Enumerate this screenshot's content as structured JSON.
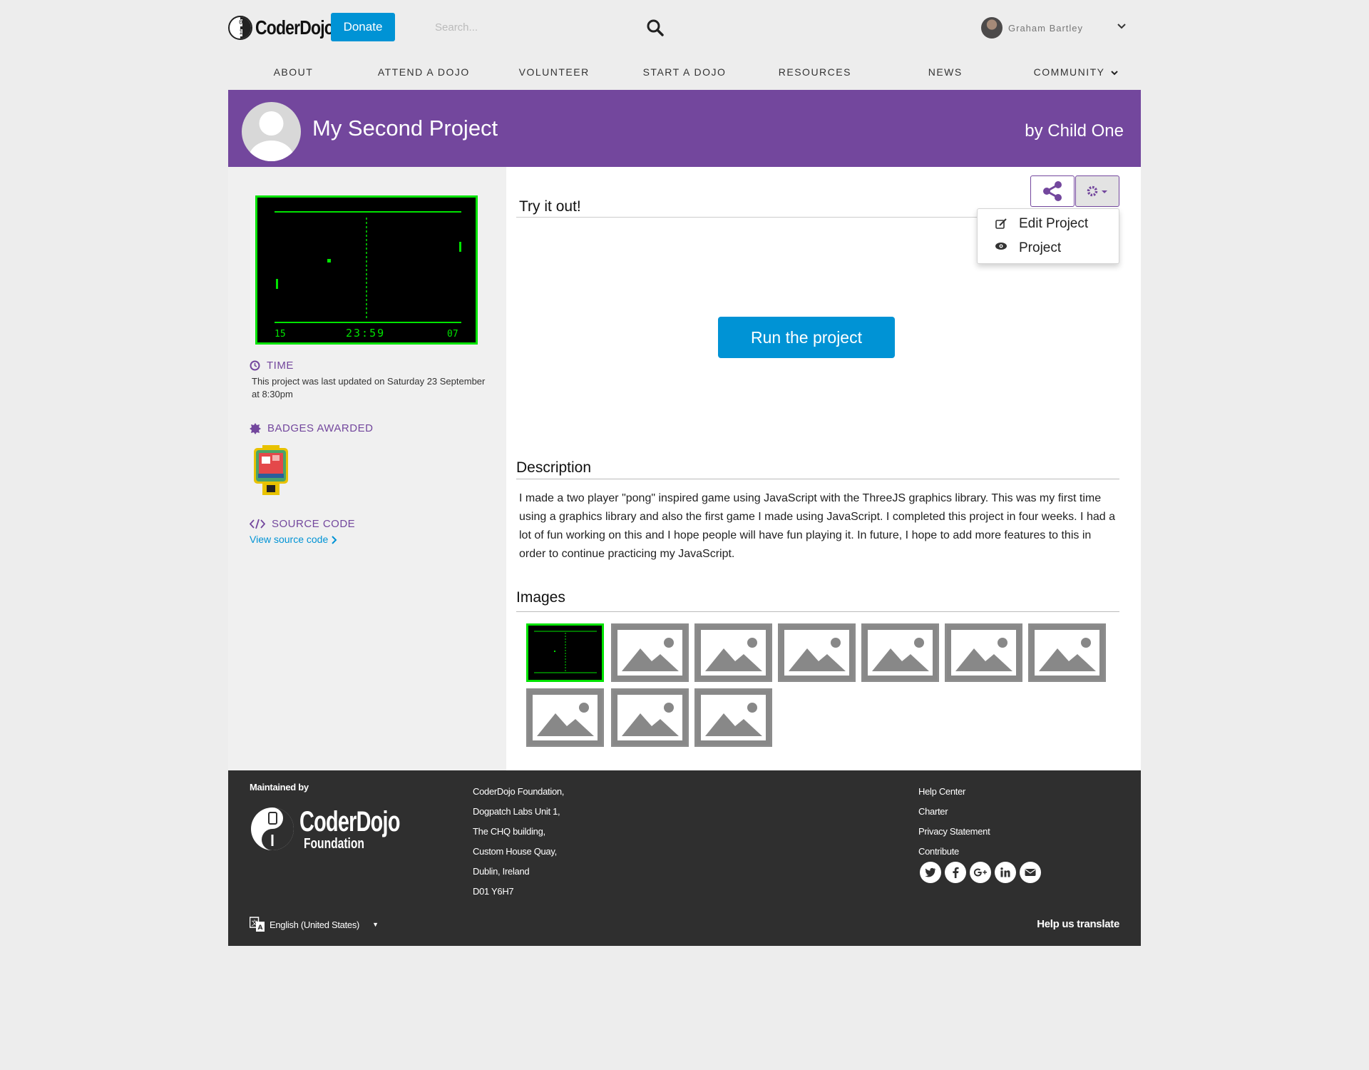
{
  "header": {
    "logo_text": "CoderDojo",
    "donate_label": "Donate",
    "search_placeholder": "Search...",
    "user_name": "Graham Bartley"
  },
  "nav": {
    "items": [
      "ABOUT",
      "ATTEND A DOJO",
      "VOLUNTEER",
      "START A DOJO",
      "RESOURCES",
      "NEWS",
      "COMMUNITY"
    ]
  },
  "banner": {
    "title": "My Second Project",
    "author": "by Child One",
    "color": "#73479d"
  },
  "sidebar": {
    "game_preview": {
      "left_score": "15",
      "clock": "23:59",
      "right_score": "07"
    },
    "time_title": "TIME",
    "time_text": "This project was last updated on Saturday 23 September at 8:30pm",
    "badges_title": "BADGES AWARDED",
    "source_title": "SOURCE CODE",
    "source_link": "View source code"
  },
  "main": {
    "try_title": "Try it out!",
    "dropdown": {
      "edit_label": "Edit Project",
      "view_label": "Project"
    },
    "run_label": "Run the project",
    "description_title": "Description",
    "description_text": "I made a two player \"pong\" inspired game using JavaScript with the ThreeJS graphics library. This was my first time using a graphics library and also the first game I made using JavaScript. I completed this project in four weeks. I had a lot of fun working on this and I hope people will have fun playing it. In future, I hope to add more features to this in order to continue practicing my JavaScript.",
    "images_title": "Images",
    "image_count": 10
  },
  "footer": {
    "maintained_by": "Maintained by",
    "logo_line1": "CoderDojo",
    "logo_line2": "Foundation",
    "address": [
      "CoderDojo Foundation,",
      "Dogpatch Labs Unit 1,",
      "The CHQ building,",
      "Custom House Quay,",
      "Dublin, Ireland",
      "D01 Y6H7"
    ],
    "links": [
      "Help Center",
      "Charter",
      "Privacy Statement",
      "Contribute"
    ],
    "social_icons": [
      "twitter-icon",
      "facebook-icon",
      "google-plus-icon",
      "linkedin-icon",
      "email-icon"
    ],
    "language": "English (United States)",
    "help_translate": "Help us translate"
  },
  "colors": {
    "accent": "#0093d5",
    "purple": "#73479d",
    "footer_bg": "#2f2f2f",
    "game_green": "#00e300"
  }
}
